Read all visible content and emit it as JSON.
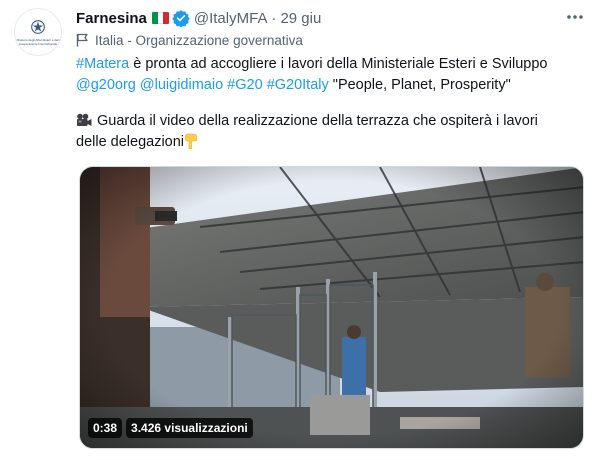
{
  "tweet": {
    "author_name": "Farnesina",
    "author_handle": "@ItalyMFA",
    "separator": "·",
    "date": "29 giu",
    "label": "Italia - Organizzazione governativa",
    "avatar_text": "Ministero degli Affari Esteri e della Cooperazione Internazionale",
    "icons": [
      "italy-flag",
      "verified-badge",
      "more-options",
      "government-flag",
      "movie-camera",
      "pointing-down"
    ],
    "text": {
      "line1_hashtag": "#Matera",
      "line1_rest": " è pronta ad accogliere i lavori della Ministeriale Esteri e Sviluppo",
      "line2_mention1": "@g20org",
      "line2_mention2": "@luigidimaio",
      "line2_hashtag1": "#G20",
      "line2_hashtag2": "#G20Italy",
      "line2_quote": " \"People, Planet, Prosperity\"",
      "line3": "Guarda il video della realizzazione della terrazza che ospiterà i lavori",
      "line4": "delle delegazioni"
    },
    "video": {
      "duration": "0:38",
      "views": "3.426 visualizzazioni"
    }
  },
  "colors": {
    "link": "#1d9bf0",
    "secondary_text": "#536471",
    "primary_text": "#0f1419",
    "flag_green": "#009246",
    "flag_white": "#ffffff",
    "flag_red": "#ce2b37"
  }
}
